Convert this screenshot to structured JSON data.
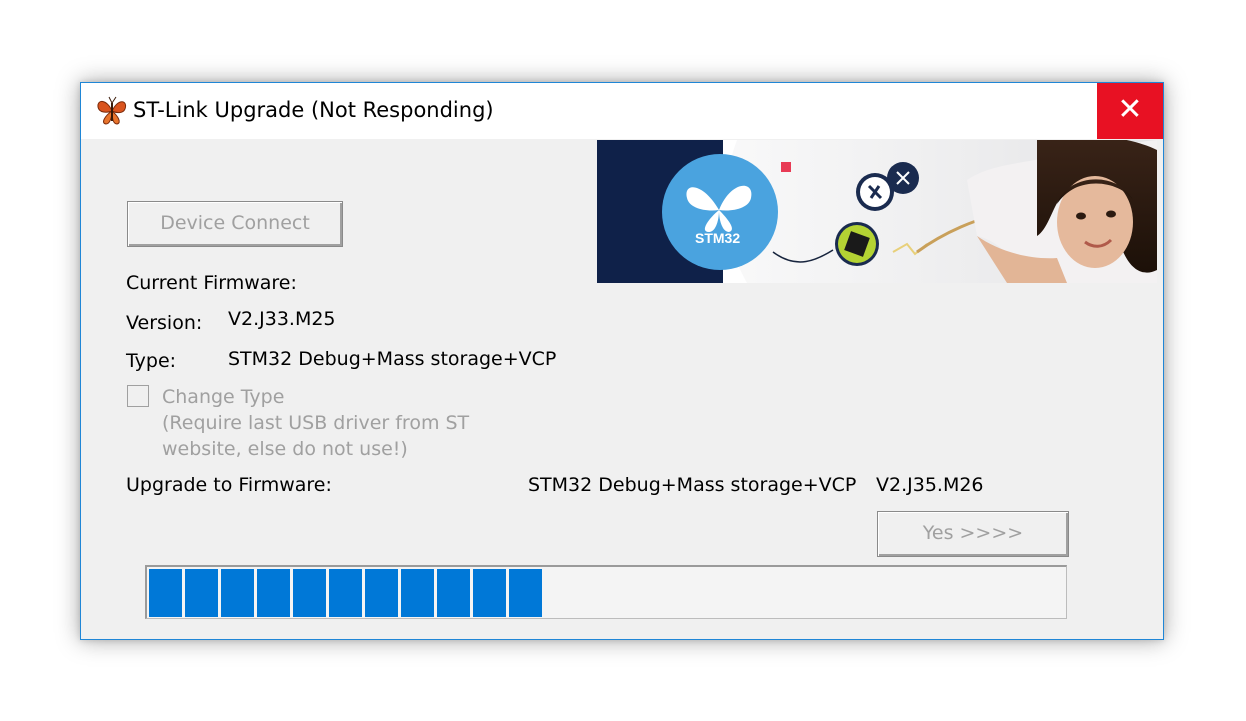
{
  "window": {
    "title": "ST-Link Upgrade (Not Responding)",
    "close_glyph": "✕"
  },
  "banner": {
    "logo_text": "STM32"
  },
  "device_connect_label": "Device Connect",
  "current_firmware": {
    "heading": "Current Firmware:",
    "version_label": "Version:",
    "version_value": "V2.J33.M25",
    "type_label": "Type:",
    "type_value": "STM32 Debug+Mass storage+VCP"
  },
  "change_type": {
    "label": "Change Type",
    "note_line1": "(Require last USB driver from ST",
    "note_line2": "website, else do not use!)",
    "checked": false
  },
  "upgrade": {
    "label": "Upgrade to Firmware:",
    "type_value": "STM32 Debug+Mass storage+VCP",
    "version_value": "V2.J35.M26"
  },
  "yes_button_label": "Yes >>>>",
  "progress": {
    "filled_segments": 11,
    "fraction": 0.43,
    "color": "#0078d7"
  },
  "colors": {
    "close_red": "#e81123",
    "accent_blue": "#1f86d6",
    "disabled_text": "#a0a0a0"
  },
  "icons": [
    "butterfly-app-icon",
    "close-icon"
  ]
}
